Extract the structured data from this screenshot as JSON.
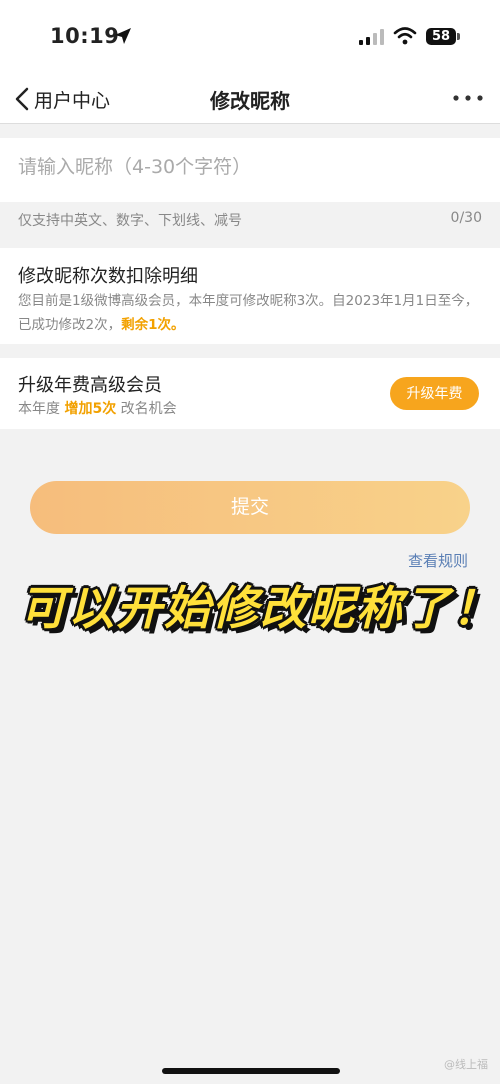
{
  "status_bar": {
    "time": "10:19",
    "battery": "58",
    "icons": [
      "location-arrow-icon",
      "cellular-signal-icon",
      "wifi-icon",
      "battery-icon"
    ]
  },
  "nav": {
    "back_label": "用户中心",
    "title": "修改昵称",
    "more_icon": "more-dots-icon"
  },
  "nickname": {
    "placeholder": "请输入昵称（4-30个字符）",
    "value": "",
    "hint": "仅支持中英文、数字、下划线、减号",
    "counter": "0/30"
  },
  "deduction": {
    "title": "修改昵称次数扣除明细",
    "desc_prefix": "您目前是1级微博高级会员，本年度可修改昵称3次。自2023年1月1日至今，已成功修改2次，",
    "desc_highlight": "剩余1次。"
  },
  "upgrade": {
    "title": "升级年费高级会员",
    "sub_prefix": "本年度",
    "sub_highlight": "增加5次",
    "sub_suffix": "改名机会",
    "button": "升级年费"
  },
  "submit_label": "提交",
  "rules_link": "查看规则",
  "overlay_caption": "可以开始修改昵称了！",
  "watermark": "@线上福",
  "colors": {
    "accent": "#f7a51d",
    "highlight": "#f2a100",
    "link": "#5a7fb5",
    "caption": "#ffe03a"
  }
}
